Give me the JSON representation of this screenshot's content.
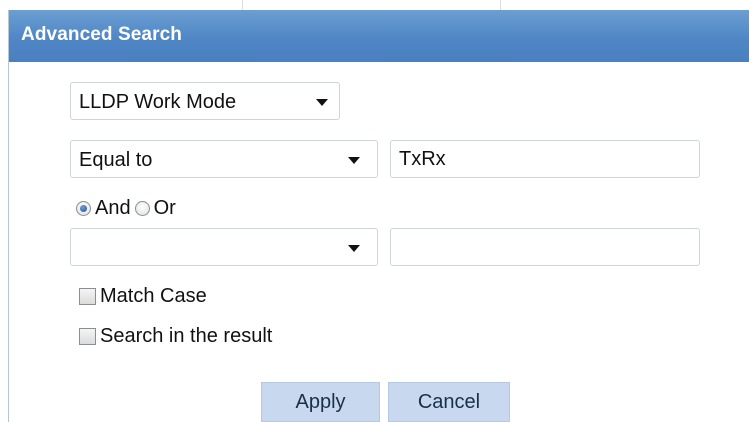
{
  "dialog": {
    "title": "Advanced Search"
  },
  "field_select": {
    "value": "LLDP Work Mode",
    "icon": "chevron-down-icon"
  },
  "condition1": {
    "operator": "Equal to",
    "value": "TxRx"
  },
  "logic": {
    "options": [
      "And",
      "Or"
    ],
    "selected": "And"
  },
  "condition2": {
    "operator": "",
    "value": ""
  },
  "options": {
    "match_case_label": "Match Case",
    "match_case_checked": false,
    "search_in_result_label": "Search in the result",
    "search_in_result_checked": false
  },
  "buttons": {
    "apply_label": "Apply",
    "cancel_label": "Cancel"
  },
  "colors": {
    "titlebar": "#4f86c5",
    "button": "#c8d8ef"
  }
}
